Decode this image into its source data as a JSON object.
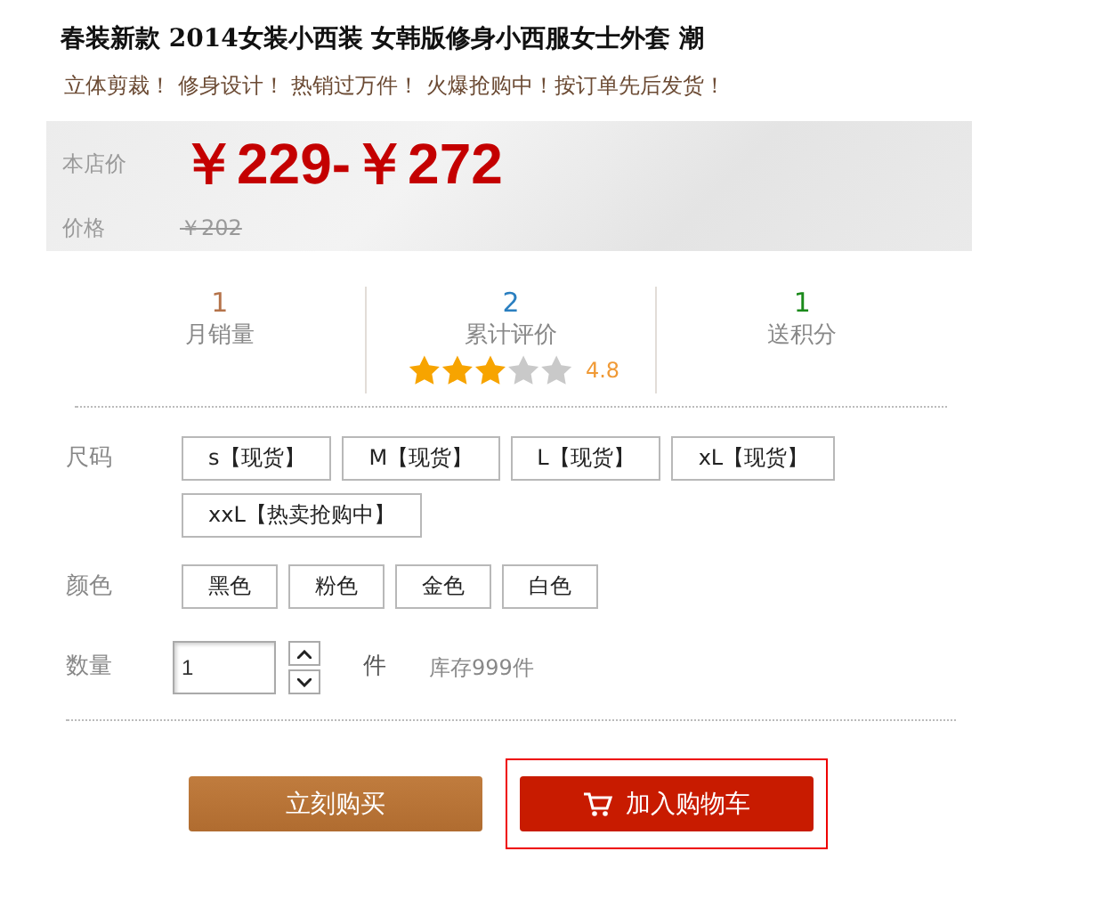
{
  "title": "春装新款 2014女装小西装 女韩版修身小西服女士外套 潮",
  "slogan": "立体剪裁！ 修身设计！ 热销过万件！ 火爆抢购中！按订单先后发货！",
  "price": {
    "label": "本店价",
    "value": "￥229-￥272",
    "original_label": "价格",
    "original_value": "￥202"
  },
  "stats": [
    {
      "value": "1",
      "label": "月销量",
      "color": "#b5734a"
    },
    {
      "value": "2",
      "label": "累计评价",
      "color": "#2a7fc0",
      "stars": 3,
      "rating": "4.8"
    },
    {
      "value": "1",
      "label": "送积分",
      "color": "#1b8a1b"
    }
  ],
  "options": [
    {
      "label": "尺码",
      "values": [
        {
          "text": "s【现货】",
          "selected": false
        },
        {
          "text": "M【现货】",
          "selected": false
        },
        {
          "text": "L【现货】",
          "selected": false
        },
        {
          "text": "xL【现货】",
          "selected": false
        },
        {
          "text": "xxL【热卖抢购中】",
          "selected": false
        }
      ]
    },
    {
      "label": "颜色",
      "values": [
        {
          "text": "黑色",
          "selected": false
        },
        {
          "text": "粉色",
          "selected": false
        },
        {
          "text": "金色",
          "selected": false
        },
        {
          "text": "白色",
          "selected": false
        }
      ]
    }
  ],
  "quantity": {
    "label": "数量",
    "value": "1",
    "unit": "件",
    "stock": "库存999件"
  },
  "buttons": [
    {
      "label": "立刻购买",
      "kind": "buy"
    },
    {
      "label": "加入购物车",
      "kind": "cart",
      "highlighted": true
    }
  ]
}
